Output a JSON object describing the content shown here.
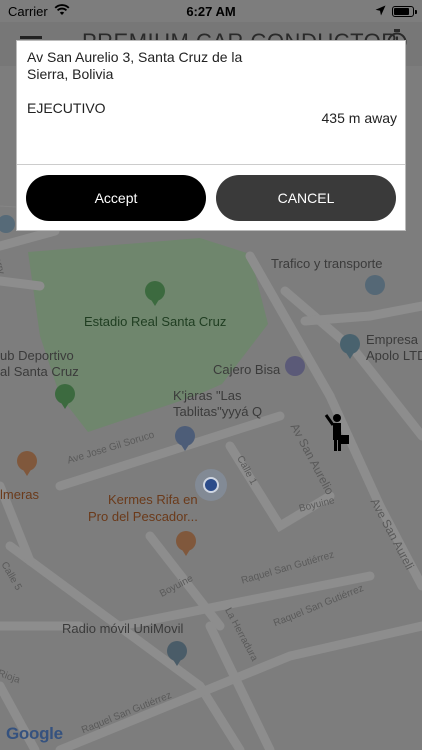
{
  "status_bar": {
    "carrier": "Carrier",
    "time": "6:27 AM"
  },
  "header": {
    "title": "PREMIUM CAR CONDUCTOR"
  },
  "dialog": {
    "address": "Av San Aurelio 3, Santa Cruz de la Sierra, Bolivia",
    "category": "EJECUTIVO",
    "distance": "435 m away",
    "accept_label": "Accept",
    "cancel_label": "CANCEL"
  },
  "map": {
    "places": {
      "trafico": "Trafico y transporte",
      "estadio": "Estadio Real Santa Cruz",
      "club_line1": "ub Deportivo",
      "club_line2": "al Santa Cruz",
      "empresa_line1": "Empresa",
      "empresa_line2": "Apolo LTD",
      "cajero": "Cajero Bisa",
      "kjaras_line1": "K'jaras \"Las",
      "kjaras_line2": "Tablitas\"yyyá Q",
      "kermes_line1": "Kermes Rifa en",
      "kermes_line2": "Pro del Pescador...",
      "radio": "Radio móvil UniMovil",
      "almeras": "lmeras"
    },
    "roads": {
      "av_san_aurelio": "Av San Aurelio",
      "ave_san_aureli": "Ave San Aureli",
      "ave_jose_gil": "Ave Jose Gil Soruco",
      "calle1": "Calle 1",
      "calle5": "Calle 5",
      "boyuine1": "Boyuine",
      "boyuine2": "Boyuine",
      "raquel1": "Raquel San Gutiérrez",
      "raquel2": "Raquel San Gutiérrez",
      "raquel3": "Raquel San Gutiérrez",
      "la_herradura": "La Herradura",
      "rioja": "Rioja",
      "ferry": "erry"
    },
    "logo": "Google"
  }
}
